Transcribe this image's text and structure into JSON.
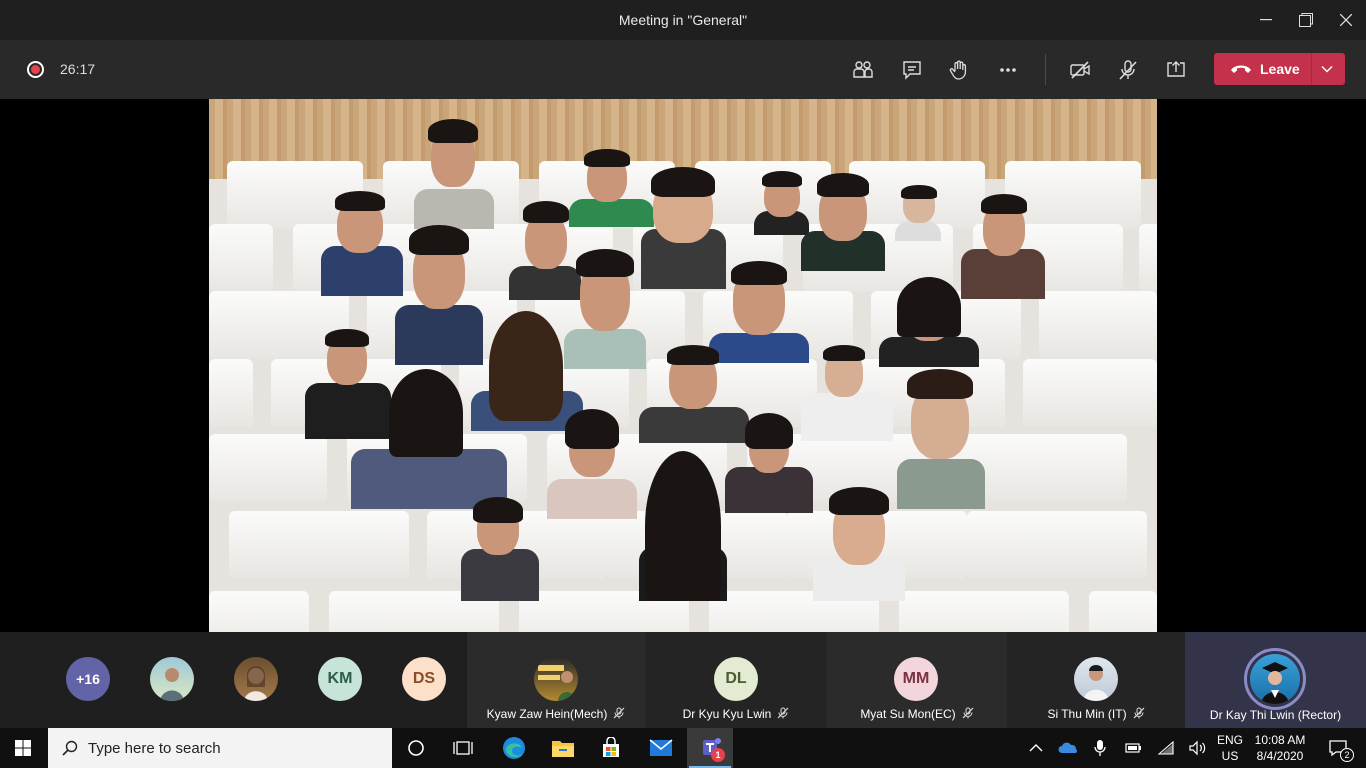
{
  "window": {
    "title": "Meeting in \"General\"",
    "minimize_icon": "minimize-icon",
    "maximize_icon": "maximize-icon",
    "close_icon": "close-icon"
  },
  "toolbar": {
    "timer": "26:17",
    "leave_label": "Leave",
    "accent_color": "#c4314b",
    "buttons": [
      "participants-icon",
      "chat-icon",
      "raise-hand-icon",
      "more-options-icon",
      "camera-off-icon",
      "mic-muted-icon",
      "share-screen-icon"
    ]
  },
  "strip": {
    "overflow_count": "+16",
    "avatars": [
      {
        "initials": "KM",
        "bg": "#c7e4d8",
        "fg": "#2c5c4a"
      },
      {
        "initials": "DS",
        "bg": "#fde0c9",
        "fg": "#8a4d26"
      }
    ],
    "tiles": [
      {
        "name": "Kyaw Zaw Hein(Mech)",
        "muted": true
      },
      {
        "name": "Dr Kyu Kyu Lwin",
        "initials": "DL",
        "muted": true
      },
      {
        "name": "Myat Su Mon(EC)",
        "initials": "MM",
        "muted": true
      },
      {
        "name": "Si Thu Min (IT)",
        "muted": true
      },
      {
        "name": "Dr Kay Thi Lwin (Rector)",
        "muted": false
      }
    ]
  },
  "taskbar": {
    "search_placeholder": "Type here to search",
    "teams_badge": "1",
    "language_line1": "ENG",
    "language_line2": "US",
    "time": "10:08 AM",
    "date": "8/4/2020",
    "notification_count": "2"
  }
}
